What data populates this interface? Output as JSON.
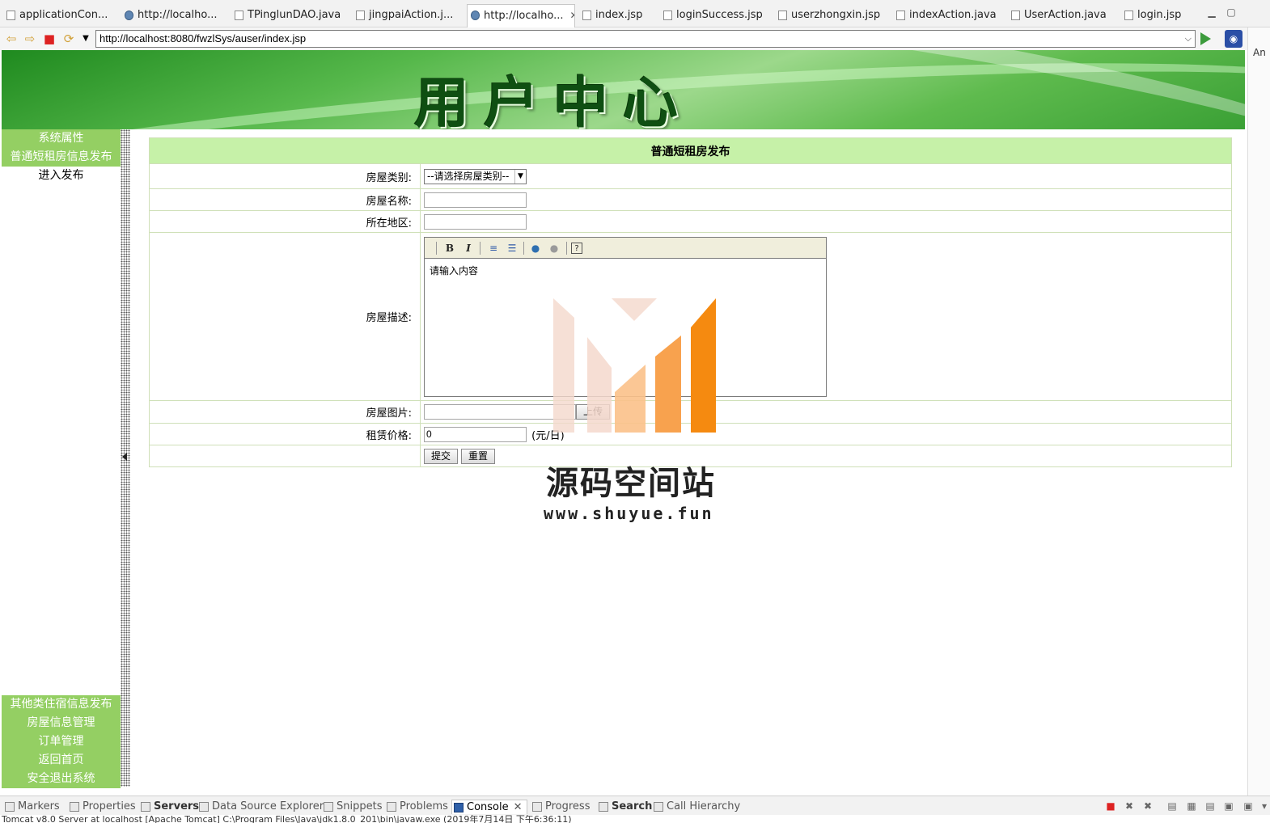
{
  "tabs": [
    {
      "label": "applicationCon...",
      "icon": "xml-file-icon"
    },
    {
      "label": "http://localho...",
      "icon": "globe-icon"
    },
    {
      "label": "TPinglunDAO.java",
      "icon": "java-file-icon"
    },
    {
      "label": "jingpaiAction.j...",
      "icon": "java-file-icon"
    },
    {
      "label": "http://localho...",
      "icon": "globe-icon",
      "active": true
    },
    {
      "label": "index.jsp",
      "icon": "jsp-file-icon"
    },
    {
      "label": "loginSuccess.jsp",
      "icon": "jsp-file-icon"
    },
    {
      "label": "userzhongxin.jsp",
      "icon": "jsp-file-icon"
    },
    {
      "label": "indexAction.java",
      "icon": "java-file-icon"
    },
    {
      "label": "UserAction.java",
      "icon": "java-file-icon"
    },
    {
      "label": "login.jsp",
      "icon": "jsp-file-icon"
    }
  ],
  "browser": {
    "url": "http://localhost:8080/fwzlSys/auser/index.jsp"
  },
  "side_gutter": {
    "label": "An"
  },
  "banner": {
    "title": "用户中心"
  },
  "menu": {
    "top": [
      {
        "label": "系统属性",
        "kind": "head"
      },
      {
        "label": "普通短租房信息发布",
        "kind": "head"
      },
      {
        "label": "进入发布",
        "kind": "sub"
      }
    ],
    "bottom": [
      {
        "label": "其他类住宿信息发布"
      },
      {
        "label": "房屋信息管理"
      },
      {
        "label": "订单管理"
      },
      {
        "label": "返回首页"
      },
      {
        "label": "安全退出系统"
      }
    ]
  },
  "form": {
    "title": "普通短租房发布",
    "type_label": "房屋类别:",
    "type_selected": "--请选择房屋类别--",
    "name_label": "房屋名称:",
    "area_label": "所在地区:",
    "desc_label": "房屋描述:",
    "desc_value": "请输入内容",
    "image_label": "房屋图片:",
    "upload_label": "上传",
    "price_label": "租赁价格:",
    "price_value": "0",
    "price_unit": "(元/日)",
    "submit_label": "提交",
    "reset_label": "重置"
  },
  "editor_tools": [
    {
      "name": "bold-icon",
      "glyph": "B"
    },
    {
      "name": "italic-icon",
      "glyph": "I"
    },
    {
      "name": "ordered-list-icon",
      "glyph": "≡"
    },
    {
      "name": "unordered-list-icon",
      "glyph": "☰"
    },
    {
      "name": "link-icon",
      "glyph": "●"
    },
    {
      "name": "unlink-icon",
      "glyph": "●"
    },
    {
      "name": "help-icon",
      "glyph": "?"
    }
  ],
  "watermark": {
    "title": "源码空间站",
    "url": "www.shuyue.fun",
    "colors": [
      "#f4d8cc",
      "#fbc18a",
      "#f8a24e",
      "#f58a10"
    ]
  },
  "bottom_tabs": [
    {
      "label": "Markers"
    },
    {
      "label": "Properties"
    },
    {
      "label": "Servers",
      "bold": true
    },
    {
      "label": "Data Source Explorer"
    },
    {
      "label": "Snippets"
    },
    {
      "label": "Problems"
    },
    {
      "label": "Console",
      "active": true
    },
    {
      "label": "Progress"
    },
    {
      "label": "Search",
      "bold": true
    },
    {
      "label": "Call Hierarchy"
    }
  ],
  "console_line": "Tomcat v8.0 Server at localhost [Apache Tomcat] C:\\Program Files\\Java\\jdk1.8.0_201\\bin\\javaw.exe (2019年7月14日 下午6:36:11)"
}
